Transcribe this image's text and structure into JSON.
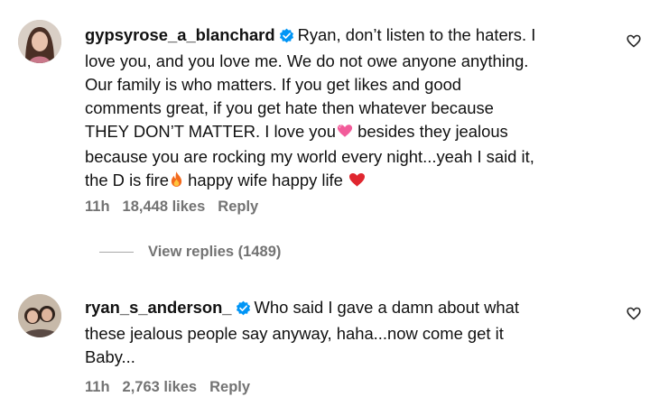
{
  "comments": [
    {
      "username": "gypsyrose_a_blanchard",
      "text_lines": [
        "Ryan, don’t listen to the haters. I",
        "love you, and you love me. We do not owe anyone anything.",
        "Our family is who matters. If you get likes and good",
        "comments great, if you get hate then whatever because",
        "THEY DON’T MATTER. I love you",
        "besides they jealous",
        "because you are rocking my world every night...yeah I said it,",
        "the D is fire",
        "happy wife happy life"
      ],
      "time": "11h",
      "likes": "18,448 likes",
      "reply_label": "Reply"
    },
    {
      "username": "ryan_s_anderson_",
      "text_lines": [
        "Who said I gave a damn about what",
        "these jealous people say anyway, haha...now come get it",
        "Baby..."
      ],
      "time": "11h",
      "likes": "2,763 likes",
      "reply_label": "Reply"
    }
  ],
  "view_replies": "View replies (1489)",
  "icons": {
    "verified_color": "#0095f6",
    "heart_outline": "heart-outline-icon",
    "sparkle_heart": "sparkling-heart-emoji",
    "fire": "fire-emoji",
    "red_heart": "red-heart-emoji"
  }
}
